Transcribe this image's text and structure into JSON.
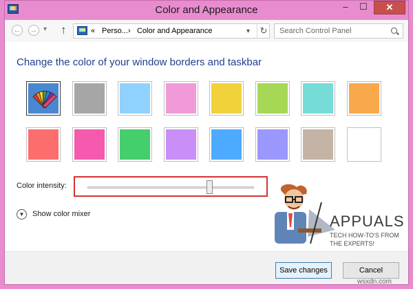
{
  "window": {
    "title": "Color and Appearance",
    "controls": {
      "minimize": "–",
      "maximize": "☐",
      "close": "✕"
    },
    "colors": {
      "frame": "#e98ccf",
      "close_button": "#c7504f",
      "heading": "#1e3f8e",
      "slider_highlight": "#d8312f"
    }
  },
  "nav": {
    "back_icon": "back-arrow-icon",
    "forward_icon": "forward-arrow-icon",
    "up_icon": "up-arrow-icon",
    "address": {
      "overflow": "«",
      "crumbs": [
        "Perso...",
        "Color and Appearance"
      ],
      "separator": "›"
    },
    "search": {
      "placeholder": "Search Control Panel"
    }
  },
  "main": {
    "heading": "Change the color of your window borders and taskbar",
    "swatches": [
      {
        "name": "automatic",
        "color": "#4a87d1",
        "selected": true
      },
      {
        "name": "gray",
        "color": "#a6a6a6"
      },
      {
        "name": "sky-blue",
        "color": "#8fd1ff"
      },
      {
        "name": "pink",
        "color": "#f19ad8"
      },
      {
        "name": "yellow",
        "color": "#f2d23b"
      },
      {
        "name": "lime",
        "color": "#a6d855"
      },
      {
        "name": "teal",
        "color": "#76dcd8"
      },
      {
        "name": "orange",
        "color": "#f9a84c"
      },
      {
        "name": "coral-red",
        "color": "#fc6d6d"
      },
      {
        "name": "magenta",
        "color": "#f55aae"
      },
      {
        "name": "green",
        "color": "#44ce6c"
      },
      {
        "name": "violet",
        "color": "#c98ef8"
      },
      {
        "name": "blue",
        "color": "#4eaaff"
      },
      {
        "name": "periwinkle",
        "color": "#9a97fd"
      },
      {
        "name": "taupe",
        "color": "#c5b4a5"
      },
      {
        "name": "white",
        "color": "#ffffff"
      }
    ],
    "intensity": {
      "label": "Color intensity:",
      "value": 0.73
    },
    "mixer": {
      "label": "Show color mixer",
      "icon": "chevron-down-icon"
    }
  },
  "footer": {
    "save_label": "Save changes",
    "cancel_label": "Cancel"
  },
  "watermark": {
    "brand_name": "APPUALS",
    "tagline_line1": "TECH HOW-TO'S FROM",
    "tagline_line2": "THE EXPERTS!",
    "site": "wsxdn.com"
  }
}
